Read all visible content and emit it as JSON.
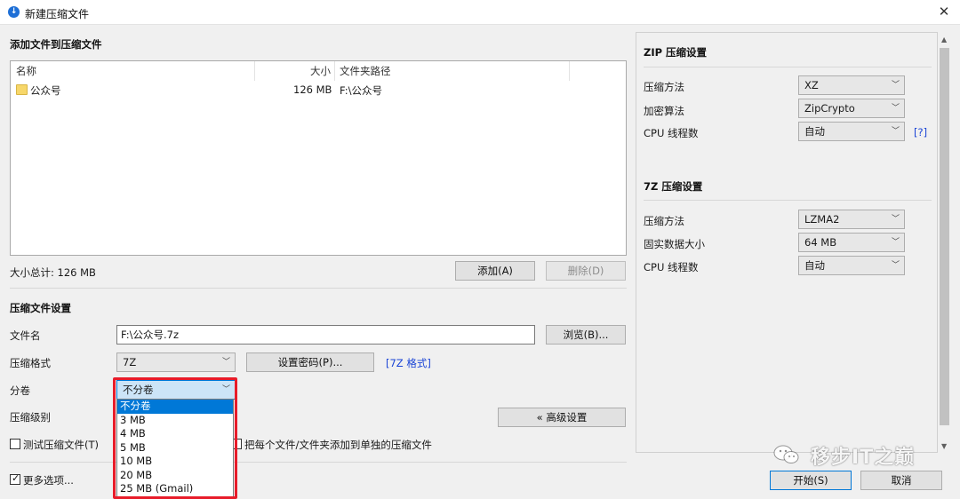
{
  "window": {
    "title": "新建压缩文件"
  },
  "files_section": {
    "title": "添加文件到压缩文件",
    "columns": [
      "名称",
      "大小",
      "文件夹路径"
    ],
    "rows": [
      {
        "name": "公众号",
        "size": "126 MB",
        "path": "F:\\公众号"
      }
    ],
    "total_label": "大小总计: 126 MB",
    "add_button": "添加(A)",
    "delete_button": "删除(D)"
  },
  "settings_section": {
    "title": "压缩文件设置",
    "filename_label": "文件名",
    "filename_value": "F:\\公众号.7z",
    "browse_button": "浏览(B)...",
    "format_label": "压缩格式",
    "format_value": "7Z",
    "password_button": "设置密码(P)...",
    "format_link": "[7Z 格式]",
    "split_label": "分卷",
    "split_value": "不分卷",
    "split_options": [
      "不分卷",
      "3 MB",
      "4 MB",
      "5 MB",
      "10 MB",
      "20 MB",
      "25 MB (Gmail)"
    ],
    "level_label": "压缩级别",
    "advanced_button": "« 高级设置",
    "test_checkbox": "测试压缩文件(T)",
    "each_file_checkbox": "把每个文件/文件夹添加到单独的压缩文件",
    "more_options": "更多选项..."
  },
  "zip_settings": {
    "title": "ZIP 压缩设置",
    "method_label": "压缩方法",
    "method_value": "XZ",
    "encrypt_label": "加密算法",
    "encrypt_value": "ZipCrypto",
    "threads_label": "CPU 线程数",
    "threads_value": "自动",
    "help_link": "[?]"
  },
  "sevenz_settings": {
    "title": "7Z 压缩设置",
    "method_label": "压缩方法",
    "method_value": "LZMA2",
    "solid_label": "固实数据大小",
    "solid_value": "64 MB",
    "threads_label": "CPU 线程数",
    "threads_value": "自动"
  },
  "footer": {
    "start_button": "开始(S)",
    "cancel_button": "取消"
  },
  "watermark": "移步IT之巅",
  "colors": {
    "accent": "#0078d7",
    "highlight_box": "#e81c2a",
    "link": "#1a44d6"
  }
}
